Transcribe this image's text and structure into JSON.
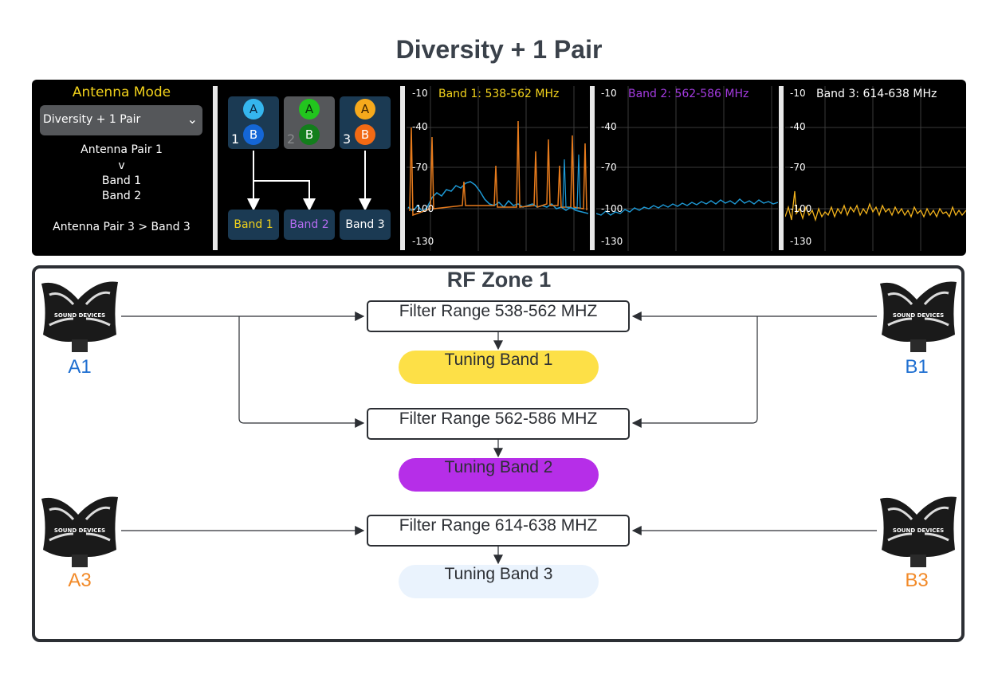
{
  "title": "Diversity + 1 Pair",
  "antenna_panel": {
    "mode_title": "Antenna Mode",
    "mode_select": "Diversity + 1 Pair",
    "mapping_lines": [
      "Antenna Pair 1",
      "v",
      "Band 1",
      "Band 2",
      "Antenna Pair 3 > Band 3"
    ],
    "pairs": [
      {
        "number": "1",
        "a": "A",
        "b": "B"
      },
      {
        "number": "2",
        "a": "A",
        "b": "B"
      },
      {
        "number": "3",
        "a": "A",
        "b": "B"
      }
    ],
    "bands": [
      "Band 1",
      "Band 2",
      "Band 3"
    ]
  },
  "spectra": [
    {
      "title": "Band 1: 538-562 MHz",
      "ticks": [
        "-10",
        "-40",
        "-70",
        "-100",
        "-130"
      ]
    },
    {
      "title": "Band 2: 562-586 MHz",
      "ticks": [
        "-10",
        "-40",
        "-70",
        "-100",
        "-130"
      ]
    },
    {
      "title": "Band 3: 614-638 MHz",
      "ticks": [
        "-10",
        "-40",
        "-70",
        "-100",
        "-130"
      ]
    }
  ],
  "rf_zone": {
    "title": "RF Zone 1",
    "filters": [
      "Filter Range 538-562 MHZ",
      "Filter Range 562-586 MHZ",
      "Filter Range 614-638 MHZ"
    ],
    "tuning_bands": [
      "Tuning Band 1",
      "Tuning Band 2",
      "Tuning Band 3"
    ],
    "antennas": {
      "a1": "A1",
      "b1": "B1",
      "a3": "A3",
      "b3": "B3"
    },
    "antenna_brand": "SOUND DEVICES"
  },
  "colors": {
    "band1": "#f2d21b",
    "band2": "#a43be0",
    "band3": "#ffffff",
    "tuning1": "#fde047",
    "tuning2": "#b62ee8",
    "tuning3": "#eaf3fd",
    "blue_label": "#1f6fd1",
    "orange_label": "#f28a28"
  }
}
